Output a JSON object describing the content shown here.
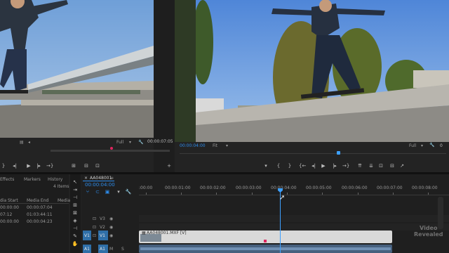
{
  "source_monitor": {
    "fit": "Full",
    "timecode": "00:00:07:05"
  },
  "program_monitor": {
    "timecode": "00:00:04:00",
    "fit": "Fit",
    "quality": "Full",
    "zoom_icon": "wrench-icon"
  },
  "project_panel": {
    "tabs": [
      "Effects",
      "Markers",
      "History"
    ],
    "item_count": "4 Items",
    "columns": [
      "dia Start",
      "Media End",
      "Media"
    ],
    "rows": [
      {
        "start": "00:00:00",
        "end": "00:00:07:04"
      },
      {
        "start": "07:12",
        "end": "01:03:44:11"
      },
      {
        "start": "00:00:00",
        "end": "00:00:04:23"
      }
    ]
  },
  "timeline": {
    "sequence_tab": "AA048001",
    "timecode": "00:00:04:00",
    "ruler_labels": [
      ":00:00",
      "00:00:01:00",
      "00:00:02:00",
      "00:00:03:00",
      "00:00:04:00",
      "00:00:05:00",
      "00:00:06:00",
      "00:00:07:00",
      "00:00:08:00"
    ],
    "tracks": [
      {
        "label": "V3",
        "target": ""
      },
      {
        "label": "V2",
        "target": ""
      },
      {
        "label": "V1",
        "target": "V1"
      },
      {
        "label": "A1",
        "target": "A1"
      }
    ],
    "clip_name": "AA048001.MXF [V]",
    "audio_mark": "S"
  },
  "watermark": {
    "line1": "Video",
    "line2": "Revealed"
  },
  "colors": {
    "accent": "#2d8ceb",
    "playhead": "#3da0ff",
    "marker": "#e0245e",
    "clip": "#d9d9d9"
  }
}
